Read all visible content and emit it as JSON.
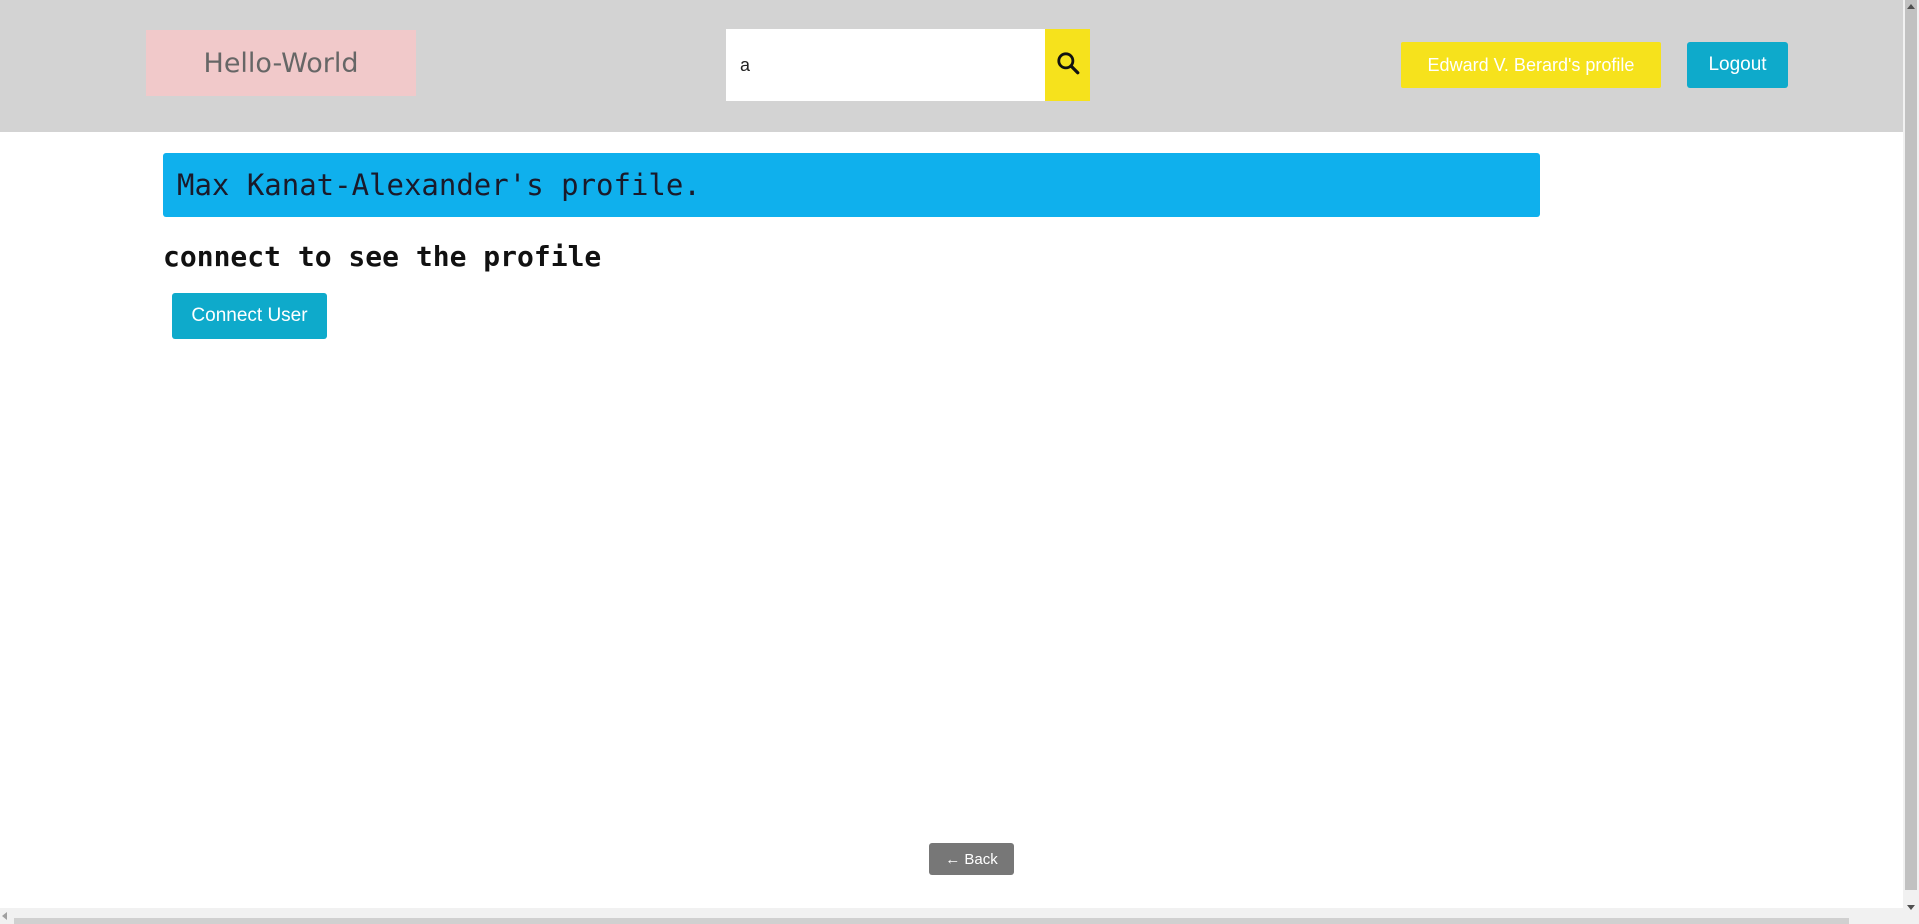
{
  "header": {
    "brand": "Hello-World",
    "search": {
      "value": "a",
      "icon": "search-icon"
    },
    "profile_button": "Edward V. Berard's profile",
    "logout_button": "Logout"
  },
  "main": {
    "profile_title": "Max Kanat-Alexander's profile.",
    "connect_message": "connect to see the profile",
    "connect_button": "Connect User",
    "back_button": "← Back"
  },
  "colors": {
    "header_bg": "#d3d3d3",
    "brand_bg": "#f1c9ca",
    "search_button_bg": "#f6e21c",
    "profile_button_bg": "#f6e21c",
    "primary_button_bg": "#0eaacb",
    "banner_bg": "#0fb0ed",
    "back_button_bg": "#777777"
  }
}
